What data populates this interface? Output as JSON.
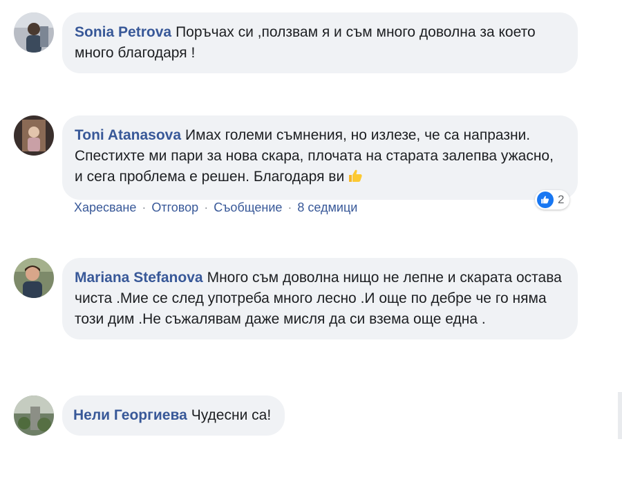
{
  "comments": [
    {
      "author": "Sonia Petrova",
      "text": "Поръчах си ,ползвам я и съм много доволна за което много благодаря !"
    },
    {
      "author": "Toni Atanasova",
      "text": "Имах големи съмнения, но излезе, че са напразни. Спестихте ми пари за нова скара, плочата на старата залепва ужасно, и сега проблема е решен. Благодаря ви",
      "emoji": "thumbs-up-emoji",
      "actions": {
        "like": "Харесване",
        "reply": "Отговор",
        "message": "Съобщение",
        "time": "8 седмици"
      },
      "reaction_count": "2"
    },
    {
      "author": "Mariana Stefanova",
      "text": "Много съм доволна нищо не лепне и скарата остава чиста .Мие се след употреба много лесно .И още по дебре че го няма този дим .Не съжалявам даже мисля да си взема още една ."
    },
    {
      "author": "Нели Георгиева",
      "text": "Чудесни са!"
    }
  ],
  "separator": "·",
  "colors": {
    "author": "#385898",
    "bubble": "#f0f2f5",
    "text": "#1c1e21",
    "like_blue": "#1877f2"
  }
}
